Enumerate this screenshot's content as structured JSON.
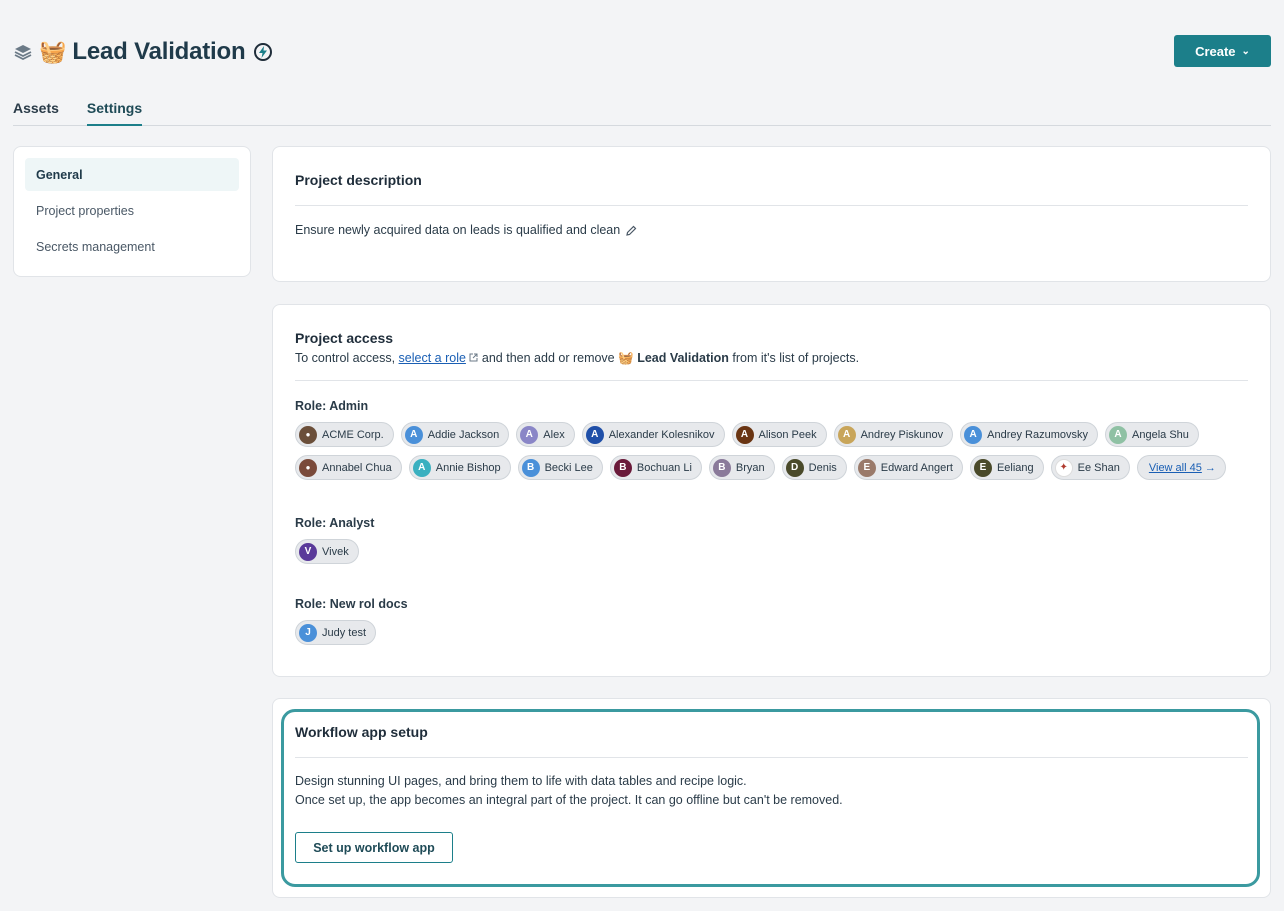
{
  "header": {
    "title": "Lead Validation",
    "stack_icon": "layers-icon",
    "emoji_icon": "basket-icon",
    "emoji_glyph": "🧺",
    "status_icon": "bolt-icon",
    "create_label": "Create"
  },
  "tabs": [
    {
      "label": "Assets",
      "active": false
    },
    {
      "label": "Settings",
      "active": true
    }
  ],
  "sidebar": {
    "items": [
      {
        "label": "General",
        "active": true
      },
      {
        "label": "Project properties",
        "active": false
      },
      {
        "label": "Secrets management",
        "active": false
      }
    ]
  },
  "description": {
    "title": "Project description",
    "text": "Ensure newly acquired data on leads is qualified and clean"
  },
  "access": {
    "title": "Project access",
    "subtitle_prefix": "To control access,",
    "link": "select a role",
    "subtitle_middle": "and then add or remove",
    "project_name": "Lead Validation",
    "subtitle_suffix": "from it's list of projects.",
    "roles": [
      {
        "title": "Role: Admin",
        "members": [
          {
            "name": "ACME Corp.",
            "initial": "",
            "color": "#6b4f3a"
          },
          {
            "name": "Addie Jackson",
            "initial": "A",
            "color": "#4a90d9"
          },
          {
            "name": "Alex",
            "initial": "A",
            "color": "#8a86c7"
          },
          {
            "name": "Alexander Kolesnikov",
            "initial": "A",
            "color": "#1f4fa8"
          },
          {
            "name": "Alison Peek",
            "initial": "A",
            "color": "#6a3513"
          },
          {
            "name": "Andrey Piskunov",
            "initial": "A",
            "color": "#c8a55a"
          },
          {
            "name": "Andrey Razumovsky",
            "initial": "A",
            "color": "#4a90d9"
          },
          {
            "name": "Angela Shu",
            "initial": "A",
            "color": "#8fc1a4"
          },
          {
            "name": "Annabel Chua",
            "initial": "",
            "color": "#7a4a3a"
          },
          {
            "name": "Annie Bishop",
            "initial": "A",
            "color": "#3ab0c0"
          },
          {
            "name": "Becki Lee",
            "initial": "B",
            "color": "#4a90d9"
          },
          {
            "name": "Bochuan Li",
            "initial": "B",
            "color": "#6a1a3a"
          },
          {
            "name": "Bryan",
            "initial": "B",
            "color": "#8a7a9a"
          },
          {
            "name": "Denis",
            "initial": "D",
            "color": "#4a4a2a"
          },
          {
            "name": "Edward Angert",
            "initial": "E",
            "color": "#9a7a6a"
          },
          {
            "name": "Eeliang",
            "initial": "E",
            "color": "#4a4a2a"
          },
          {
            "name": "Ee Shan",
            "initial": "",
            "color": "#ffffff"
          }
        ],
        "view_all": "View all 45"
      },
      {
        "title": "Role: Analyst",
        "members": [
          {
            "name": "Vivek",
            "initial": "V",
            "color": "#5a3a9a"
          }
        ]
      },
      {
        "title": "Role: New rol docs",
        "members": [
          {
            "name": "Judy test",
            "initial": "J",
            "color": "#4a90d9"
          }
        ]
      }
    ]
  },
  "workflow": {
    "title": "Workflow app setup",
    "line1": "Design stunning UI pages, and bring them to life with data tables and recipe logic.",
    "line2": "Once set up, the app becomes an integral part of the project. It can go offline but can't be removed.",
    "button": "Set up workflow app"
  }
}
